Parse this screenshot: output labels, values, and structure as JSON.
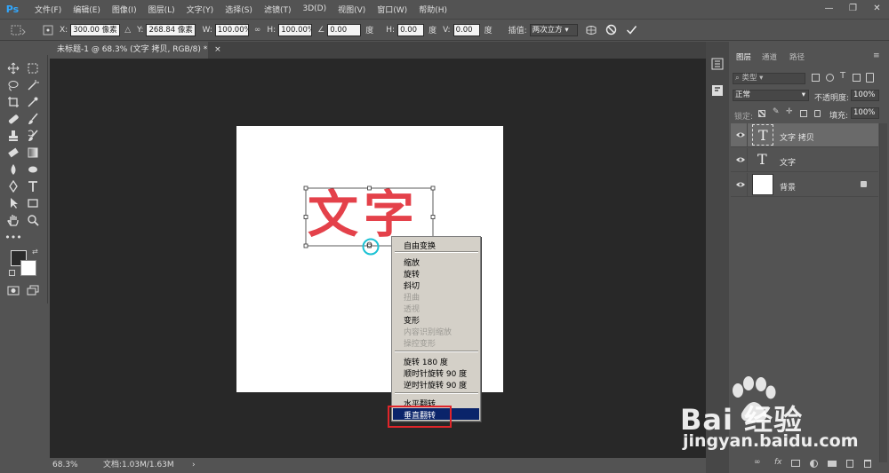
{
  "app": {
    "logo": "Ps"
  },
  "menu": [
    "文件(F)",
    "编辑(E)",
    "图像(I)",
    "图层(L)",
    "文字(Y)",
    "选择(S)",
    "滤镜(T)",
    "3D(D)",
    "视图(V)",
    "窗口(W)",
    "帮助(H)"
  ],
  "window_controls": {
    "minimize": "—",
    "maximize": "❐",
    "close": "✕"
  },
  "options": {
    "x_label": "X:",
    "x_value": "300.00 像素",
    "y_label": "Y:",
    "y_value": "268.84 像素",
    "w_label": "W:",
    "w_value": "100.00%",
    "h_label": "H:",
    "h_value": "100.00%",
    "angle_value": "0.00",
    "angle_unit": "度",
    "hskew_label": "H:",
    "hskew_value": "0.00",
    "hskew_unit": "度",
    "vskew_label": "V:",
    "vskew_value": "0.00",
    "vskew_unit": "度",
    "interp_label": "插值:",
    "interp_value": "两次立方"
  },
  "document": {
    "tab_title": "未标题-1 @ 68.3% (文字 拷贝, RGB/8) *",
    "tab_close": "×",
    "canvas_text": "文字"
  },
  "status": {
    "zoom": "68.3%",
    "doc_info": "文档:1.03M/1.63M",
    "arrow": "›"
  },
  "context_menu": {
    "items": [
      {
        "label": "自由变换",
        "enabled": true
      },
      {
        "label": "缩放",
        "enabled": true
      },
      {
        "label": "旋转",
        "enabled": true
      },
      {
        "label": "斜切",
        "enabled": true
      },
      {
        "label": "扭曲",
        "enabled": false
      },
      {
        "label": "透视",
        "enabled": false
      },
      {
        "label": "变形",
        "enabled": true
      },
      {
        "label": "内容识别缩放",
        "enabled": false
      },
      {
        "label": "操控变形",
        "enabled": false
      },
      {
        "label": "旋转 180 度",
        "enabled": true
      },
      {
        "label": "顺时针旋转 90 度",
        "enabled": true
      },
      {
        "label": "逆时针旋转 90 度",
        "enabled": true
      },
      {
        "label": "水平翻转",
        "enabled": true
      },
      {
        "label": "垂直翻转",
        "enabled": true,
        "highlighted": true
      }
    ]
  },
  "layers_panel": {
    "tabs": [
      "图层",
      "通道",
      "路径"
    ],
    "filter_kind": "类型",
    "blend_mode": "正常",
    "opacity_label": "不透明度:",
    "opacity_value": "100%",
    "lock_label": "锁定:",
    "fill_label": "填充:",
    "fill_value": "100%",
    "layers": [
      {
        "name": "文字 拷贝",
        "type": "text",
        "selected": true
      },
      {
        "name": "文字",
        "type": "text",
        "selected": false
      },
      {
        "name": "背景",
        "type": "background",
        "selected": false,
        "locked": true
      }
    ],
    "bottom_icons": [
      "link-icon",
      "fx-icon",
      "mask-icon",
      "adjustment-icon",
      "group-icon",
      "new-layer-icon",
      "trash-icon"
    ]
  },
  "watermark": {
    "brand": "Bai  经验",
    "url": "jingyan.baidu.com"
  },
  "colors": {
    "accent_blue": "#31a8ff",
    "text_red": "#e4414a",
    "menu_highlight": "#0a246a",
    "highlight_box": "#e0252a",
    "pivot_cyan": "#1cc2d4"
  }
}
